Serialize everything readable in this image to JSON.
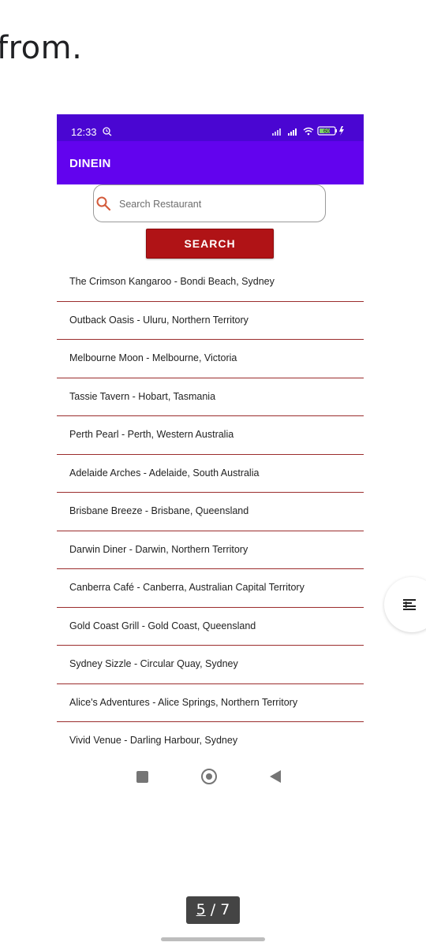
{
  "document": {
    "visible_text": "from."
  },
  "status_bar": {
    "time": "12:33",
    "battery": "60"
  },
  "app": {
    "title": "DINEIN"
  },
  "search": {
    "placeholder": "Search Restaurant",
    "button_label": "SEARCH"
  },
  "restaurants": [
    "The Crimson Kangaroo - Bondi Beach, Sydney",
    "Outback Oasis - Uluru, Northern Territory",
    "Melbourne Moon - Melbourne, Victoria",
    "Tassie Tavern - Hobart, Tasmania",
    "Perth Pearl - Perth, Western Australia",
    "Adelaide Arches - Adelaide, South Australia",
    "Brisbane Breeze - Brisbane, Queensland",
    "Darwin Diner - Darwin, Northern Territory",
    "Canberra Café - Canberra, Australian Capital Territory",
    "Gold Coast Grill - Gold Coast, Queensland",
    "Sydney Sizzle - Circular Quay, Sydney",
    "Alice's Adventures - Alice Springs, Northern Territory",
    "Vivid Venue - Darling Harbour, Sydney"
  ],
  "pagination": {
    "current": "5",
    "separator": " / ",
    "total": "7"
  },
  "colors": {
    "status_bar": "#4a06d2",
    "app_bar": "#6203ee",
    "search_button": "#b01316",
    "divider": "#9b2d2d",
    "search_icon": "#d35a3a"
  },
  "icons": {
    "status_bar": [
      "alarm-icon",
      "signal-icon",
      "wifi-icon",
      "battery-icon",
      "charging-icon"
    ],
    "search": "search-icon",
    "navigation": [
      "recent-apps-icon",
      "home-icon",
      "back-icon"
    ],
    "floating": "list-view-icon"
  }
}
